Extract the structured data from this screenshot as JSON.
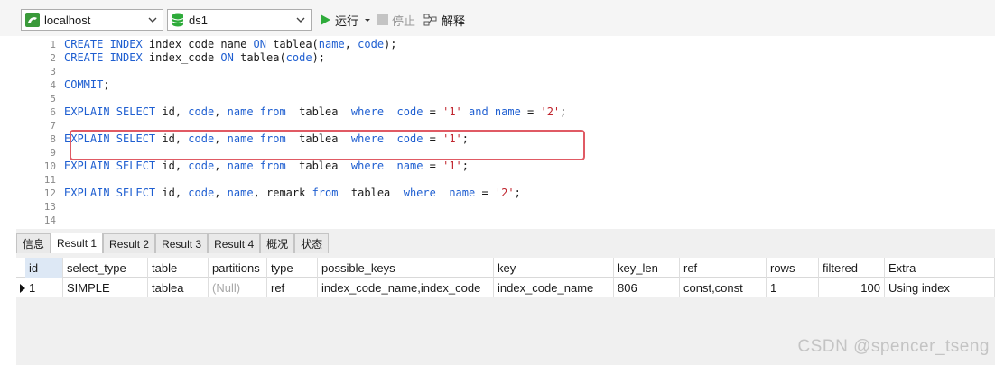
{
  "toolbar": {
    "connection": "localhost",
    "database": "ds1",
    "run_label": "运行",
    "stop_label": "停止",
    "explain_label": "解释"
  },
  "editor": {
    "line_numbers": [
      "1",
      "2",
      "3",
      "4",
      "5",
      "6",
      "7",
      "8",
      "9",
      "10",
      "11",
      "12",
      "13",
      "14"
    ],
    "lines": [
      [
        {
          "t": "CREATE INDEX ",
          "c": "kw"
        },
        {
          "t": "index_code_name ",
          "c": ""
        },
        {
          "t": "ON ",
          "c": "kw"
        },
        {
          "t": "tablea(",
          "c": ""
        },
        {
          "t": "name",
          "c": "kw"
        },
        {
          "t": ", ",
          "c": ""
        },
        {
          "t": "code",
          "c": "kw"
        },
        {
          "t": ");",
          "c": ""
        }
      ],
      [
        {
          "t": "CREATE INDEX ",
          "c": "kw"
        },
        {
          "t": "index_code ",
          "c": ""
        },
        {
          "t": "ON ",
          "c": "kw"
        },
        {
          "t": "tablea(",
          "c": ""
        },
        {
          "t": "code",
          "c": "kw"
        },
        {
          "t": ");",
          "c": ""
        }
      ],
      [],
      [
        {
          "t": "COMMIT",
          "c": "kw"
        },
        {
          "t": ";",
          "c": ""
        }
      ],
      [],
      [
        {
          "t": "EXPLAIN SELECT ",
          "c": "kw"
        },
        {
          "t": "id, ",
          "c": ""
        },
        {
          "t": "code",
          "c": "kw"
        },
        {
          "t": ", ",
          "c": ""
        },
        {
          "t": "name ",
          "c": "kw"
        },
        {
          "t": "from ",
          "c": "kw"
        },
        {
          "t": " tablea  ",
          "c": ""
        },
        {
          "t": "where ",
          "c": "kw"
        },
        {
          "t": " ",
          "c": ""
        },
        {
          "t": "code ",
          "c": "kw"
        },
        {
          "t": "= ",
          "c": ""
        },
        {
          "t": "'1' ",
          "c": "str"
        },
        {
          "t": "and ",
          "c": "kw"
        },
        {
          "t": "name ",
          "c": "kw"
        },
        {
          "t": "= ",
          "c": ""
        },
        {
          "t": "'2'",
          "c": "str"
        },
        {
          "t": ";",
          "c": ""
        }
      ],
      [],
      [
        {
          "t": "EXPLAIN SELECT ",
          "c": "kw"
        },
        {
          "t": "id, ",
          "c": ""
        },
        {
          "t": "code",
          "c": "kw"
        },
        {
          "t": ", ",
          "c": ""
        },
        {
          "t": "name ",
          "c": "kw"
        },
        {
          "t": "from ",
          "c": "kw"
        },
        {
          "t": " tablea  ",
          "c": ""
        },
        {
          "t": "where ",
          "c": "kw"
        },
        {
          "t": " ",
          "c": ""
        },
        {
          "t": "code ",
          "c": "kw"
        },
        {
          "t": "= ",
          "c": ""
        },
        {
          "t": "'1'",
          "c": "str"
        },
        {
          "t": ";",
          "c": ""
        }
      ],
      [],
      [
        {
          "t": "EXPLAIN SELECT ",
          "c": "kw"
        },
        {
          "t": "id, ",
          "c": ""
        },
        {
          "t": "code",
          "c": "kw"
        },
        {
          "t": ", ",
          "c": ""
        },
        {
          "t": "name ",
          "c": "kw"
        },
        {
          "t": "from ",
          "c": "kw"
        },
        {
          "t": " tablea  ",
          "c": ""
        },
        {
          "t": "where ",
          "c": "kw"
        },
        {
          "t": " ",
          "c": ""
        },
        {
          "t": "name ",
          "c": "kw"
        },
        {
          "t": "= ",
          "c": ""
        },
        {
          "t": "'1'",
          "c": "str"
        },
        {
          "t": ";",
          "c": ""
        }
      ],
      [],
      [
        {
          "t": "EXPLAIN SELECT ",
          "c": "kw"
        },
        {
          "t": "id, ",
          "c": ""
        },
        {
          "t": "code",
          "c": "kw"
        },
        {
          "t": ", ",
          "c": ""
        },
        {
          "t": "name",
          "c": "kw"
        },
        {
          "t": ", remark ",
          "c": ""
        },
        {
          "t": "from ",
          "c": "kw"
        },
        {
          "t": " tablea  ",
          "c": ""
        },
        {
          "t": "where ",
          "c": "kw"
        },
        {
          "t": " ",
          "c": ""
        },
        {
          "t": "name ",
          "c": "kw"
        },
        {
          "t": "= ",
          "c": ""
        },
        {
          "t": "'2'",
          "c": "str"
        },
        {
          "t": ";",
          "c": ""
        }
      ],
      [],
      []
    ]
  },
  "result_tabs": [
    "信息",
    "Result 1",
    "Result 2",
    "Result 3",
    "Result 4",
    "概况",
    "状态"
  ],
  "active_tab": "Result 1",
  "table": {
    "columns": [
      "id",
      "select_type",
      "table",
      "partitions",
      "type",
      "possible_keys",
      "key",
      "key_len",
      "ref",
      "rows",
      "filtered",
      "Extra"
    ],
    "rows": [
      [
        "1",
        "SIMPLE",
        "tablea",
        "(Null)",
        "ref",
        "index_code_name,index_code",
        "index_code_name",
        "806",
        "const,const",
        "1",
        "100",
        "Using index"
      ]
    ]
  },
  "watermark": "CSDN @spencer_tseng",
  "colors": {
    "keyword": "#1f5fd1",
    "string": "#c0252e",
    "highlight_border": "#e05a64",
    "run_icon": "#2eab3a"
  }
}
